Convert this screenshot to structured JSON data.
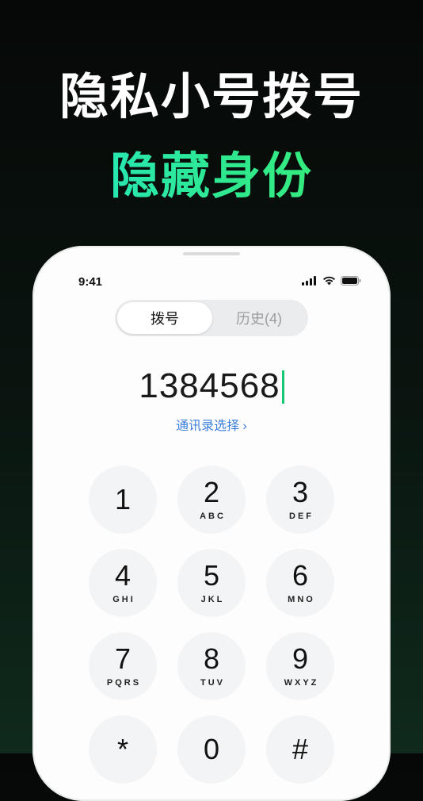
{
  "headline": {
    "line1": "隐私小号拨号",
    "line2": "隐藏身份"
  },
  "status_bar": {
    "time": "9:41"
  },
  "tabs": [
    {
      "label": "拨号",
      "active": true
    },
    {
      "label": "历史(4)",
      "active": false
    }
  ],
  "dialer": {
    "number": "1384568",
    "contacts_link": "通讯录选择 ›",
    "keys": [
      {
        "digit": "1",
        "letters": ""
      },
      {
        "digit": "2",
        "letters": "ABC"
      },
      {
        "digit": "3",
        "letters": "DEF"
      },
      {
        "digit": "4",
        "letters": "GHI"
      },
      {
        "digit": "5",
        "letters": "JKL"
      },
      {
        "digit": "6",
        "letters": "MNO"
      },
      {
        "digit": "7",
        "letters": "PQRS"
      },
      {
        "digit": "8",
        "letters": "TUV"
      },
      {
        "digit": "9",
        "letters": "WXYZ"
      },
      {
        "digit": "*",
        "letters": ""
      },
      {
        "digit": "0",
        "letters": ""
      },
      {
        "digit": "#",
        "letters": ""
      }
    ]
  },
  "colors": {
    "accent": "#3b7fdd",
    "caret": "#17c774",
    "headline_gradient": [
      "#22e6d0",
      "#3df06a"
    ]
  }
}
